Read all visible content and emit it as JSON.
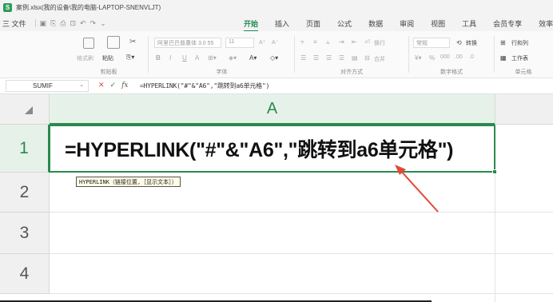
{
  "titlebar": {
    "logo": "S",
    "title": "案例.xlsx(我的设备\\我的电脑-LAPTOP-SNENVLJT)"
  },
  "menubar": {
    "file_menu": "三 文件",
    "quick_access_icons": [
      "save-icon",
      "print-icon",
      "undo-icon",
      "redo-icon",
      "chevron-down-icon"
    ],
    "tabs": [
      {
        "label": "开始",
        "active": true
      },
      {
        "label": "插入",
        "active": false
      },
      {
        "label": "页面",
        "active": false
      },
      {
        "label": "公式",
        "active": false
      },
      {
        "label": "数据",
        "active": false
      },
      {
        "label": "审阅",
        "active": false
      },
      {
        "label": "视图",
        "active": false
      },
      {
        "label": "工具",
        "active": false
      },
      {
        "label": "会员专享",
        "active": false
      },
      {
        "label": "效率",
        "active": false
      }
    ]
  },
  "ribbon": {
    "clipboard": {
      "format_painter": "格式刷",
      "paste": "粘贴",
      "group_label": "剪贴板"
    },
    "font": {
      "font_name": "阿里巴巴普惠体 3.0 55",
      "font_size": "11",
      "group_label": "字体"
    },
    "alignment": {
      "wrap": "换行",
      "merge": "合并",
      "group_label": "对齐方式"
    },
    "number": {
      "format": "常规",
      "convert": "转换",
      "group_label": "数字格式"
    },
    "cells": {
      "row_col": "行和列",
      "worksheet": "工作表",
      "group_label": "单元格"
    }
  },
  "formula_bar": {
    "name_box": "SUMIF",
    "formula": "=HYPERLINK(\"#\"&\"A6\",\"跳转到a6单元格\")"
  },
  "grid": {
    "column_header": "A",
    "rows": [
      "1",
      "2",
      "3",
      "4"
    ],
    "active_cell_content": "=HYPERLINK(\"#\"&\"A6\",\"跳转到a6单元格\")",
    "tooltip": "HYPERLINK（链接位置,［显示文本］）"
  },
  "colors": {
    "accent": "#2a8a4f",
    "arrow": "#e04a3a"
  }
}
